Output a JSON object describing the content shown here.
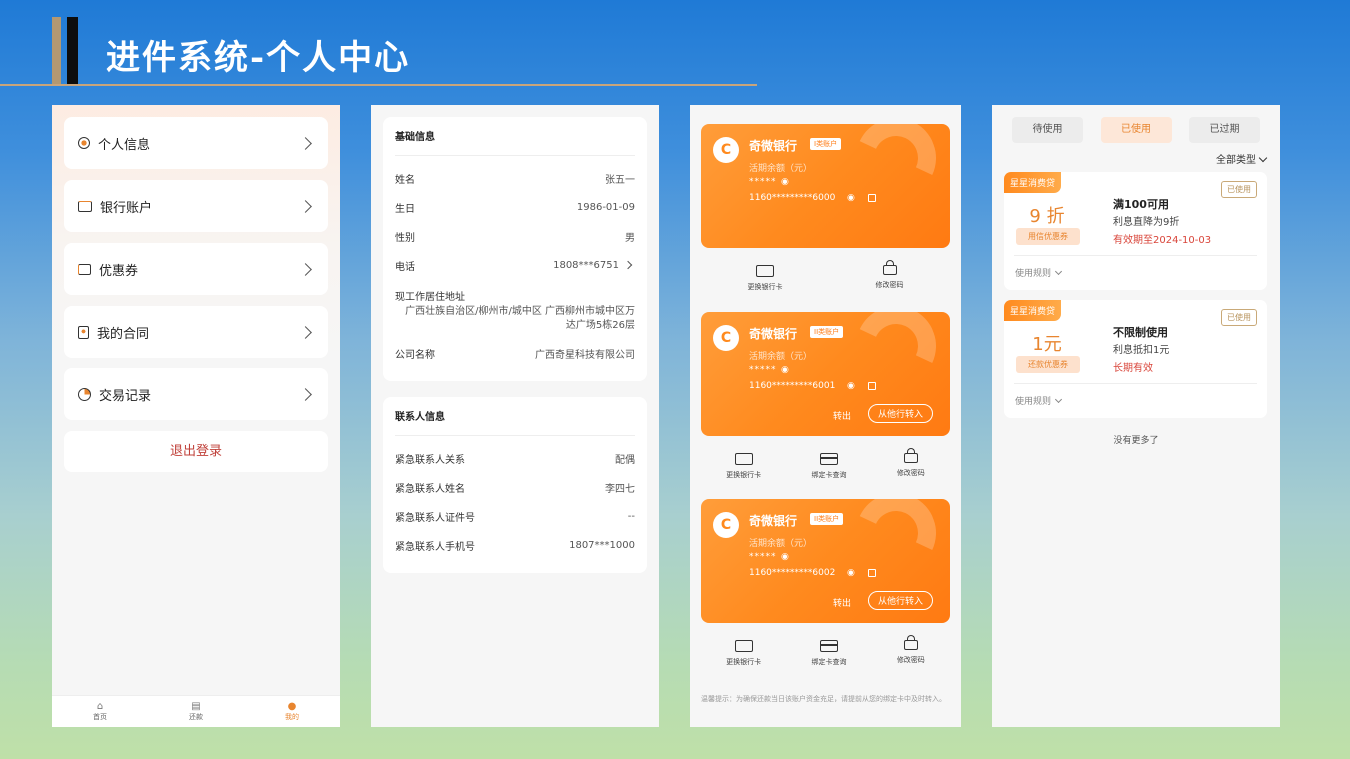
{
  "header": {
    "title": "进件系统-个人中心"
  },
  "p1": {
    "menu": [
      {
        "label": "个人信息",
        "icon": "user-icon"
      },
      {
        "label": "银行账户",
        "icon": "wallet-icon"
      },
      {
        "label": "优惠券",
        "icon": "coupon-icon"
      },
      {
        "label": "我的合同",
        "icon": "contract-icon"
      },
      {
        "label": "交易记录",
        "icon": "clock-icon"
      }
    ],
    "logout": "退出登录",
    "tabs": [
      {
        "label": "首页",
        "icon": "home-icon"
      },
      {
        "label": "还款",
        "icon": "repay-icon"
      },
      {
        "label": "我的",
        "icon": "profile-icon"
      }
    ]
  },
  "p2": {
    "basic": {
      "title": "基础信息",
      "name_l": "姓名",
      "name_v": "张五一",
      "birth_l": "生日",
      "birth_v": "1986-01-09",
      "gender_l": "性别",
      "gender_v": "男",
      "phone_l": "电话",
      "phone_v": "1808***6751",
      "addr_l": "现工作居住地址",
      "addr_v": "广西壮族自治区/柳州市/城中区 广西柳州市城中区万达广场5栋26层",
      "company_l": "公司名称",
      "company_v": "广西奇星科技有限公司"
    },
    "contact": {
      "title": "联系人信息",
      "rel_l": "紧急联系人关系",
      "rel_v": "配偶",
      "name_l": "紧急联系人姓名",
      "name_v": "李四七",
      "id_l": "紧急联系人证件号",
      "id_v": "--",
      "phone_l": "紧急联系人手机号",
      "phone_v": "1807***1000"
    }
  },
  "p3": {
    "cards": [
      {
        "bank": "奇微银行",
        "badge": "I类账户",
        "balance_label": "活期余额（元）",
        "stars": "*****",
        "account": "1160*********6000"
      },
      {
        "bank": "奇微银行",
        "badge": "II类账户",
        "balance_label": "活期余额（元）",
        "stars": "*****",
        "account": "1160*********6001",
        "out": "转出",
        "transfer_in": "从他行转入"
      },
      {
        "bank": "奇微银行",
        "badge": "II类账户",
        "balance_label": "活期余额（元）",
        "stars": "*****",
        "account": "1160*********6002",
        "out": "转出",
        "transfer_in": "从他行转入"
      }
    ],
    "actions": {
      "change": "更换银行卡",
      "bind": "绑定卡查询",
      "pwd": "修改密码"
    },
    "tip": "温馨提示：为确保还款当日该账户资金充足，请提前从您的绑定卡中及时转入。"
  },
  "p4": {
    "tabs": [
      "待使用",
      "已使用",
      "已过期"
    ],
    "filter": "全部类型",
    "coupons": [
      {
        "tag": "星星消费贷",
        "amount": "9 折",
        "type": "用信优惠券",
        "title": "满100可用",
        "desc": "利息直降为9折",
        "validity": "有效期至2024-10-03",
        "status": "已使用",
        "rule": "使用规则"
      },
      {
        "tag": "星星消费贷",
        "amount": "1元",
        "type": "还款优惠券",
        "title": "不限制使用",
        "desc": "利息抵扣1元",
        "validity": "长期有效",
        "status": "已使用",
        "rule": "使用规则"
      }
    ],
    "nomore": "没有更多了"
  },
  "colors": {
    "accent": "#e8852f",
    "card_orange": "#ff8a1e",
    "danger": "#d9453a"
  }
}
